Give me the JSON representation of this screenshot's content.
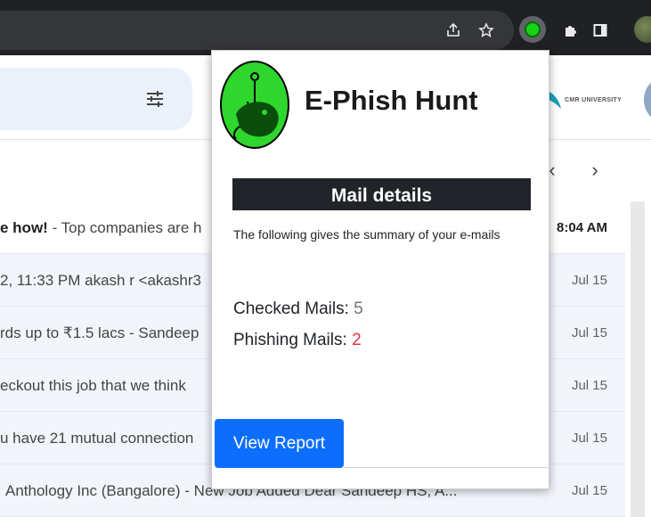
{
  "popup": {
    "app_title": "E-Phish Hunt",
    "section_title": "Mail details",
    "summary": "The following gives the summary of your e-mails",
    "checked_label": "Checked Mails:",
    "checked_value": "5",
    "phishing_label": "Phishing Mails:",
    "phishing_value": "2",
    "view_report_label": "View Report"
  },
  "gmail": {
    "cmr_logo_text": "CMR UNIVERSITY",
    "emails": [
      {
        "bold": "e how!",
        "snippet": " - Top companies are h",
        "date": "8:04 AM",
        "unread": true
      },
      {
        "bold": "",
        "snippet": "2, 11:33 PM akash r <akashr3",
        "date": "Jul 15",
        "unread": false
      },
      {
        "bold": "",
        "snippet": "rds up to ₹1.5 lacs - Sandeep",
        "date": "Jul 15",
        "unread": false
      },
      {
        "bold": "",
        "snippet": "eckout this job that we think",
        "date": "Jul 15",
        "unread": false
      },
      {
        "bold": "",
        "snippet": "u have 21 mutual connection",
        "date": "Jul 15",
        "unread": false
      },
      {
        "bold": "",
        "snippet": "Anthology Inc (Bangalore) - New Job Added Dear Sandeep HS, A...",
        "date": "Jul 15",
        "unread": false
      }
    ]
  },
  "colors": {
    "brand_green": "#2ed62e",
    "button_blue": "#0d6efd",
    "phishing_red": "#dc3545",
    "header_dark": "#212529"
  },
  "icons": [
    "share-icon",
    "star-icon",
    "extension-icon",
    "puzzle-icon",
    "sidepanel-icon",
    "profile-avatar",
    "tune-icon",
    "chevron-left-icon",
    "chevron-right-icon"
  ]
}
